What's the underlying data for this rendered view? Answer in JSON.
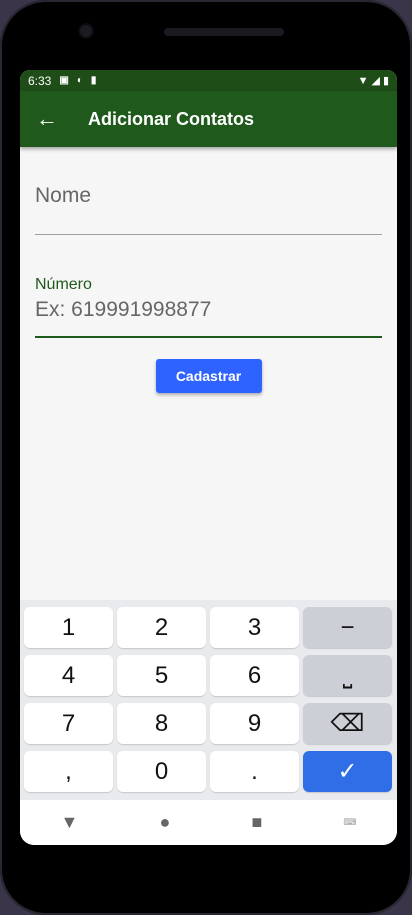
{
  "status_bar": {
    "time": "6:33",
    "icons": [
      "a-icon",
      "p-icon",
      "sd-card-icon"
    ],
    "right_icons": [
      "wifi-icon",
      "signal-icon",
      "battery-icon"
    ]
  },
  "app_bar": {
    "title": "Adicionar Contatos",
    "back_icon": "arrow-back-icon"
  },
  "form": {
    "name_placeholder": "Nome",
    "number_label": "Número",
    "number_placeholder": "Ex: 619991998877",
    "submit_label": "Cadastrar"
  },
  "keyboard": {
    "rows": [
      [
        "1",
        "2",
        "3",
        "−"
      ],
      [
        "4",
        "5",
        "6",
        "⎵"
      ],
      [
        "7",
        "8",
        "9",
        "⌫"
      ],
      [
        ",",
        "0",
        ".",
        "✓"
      ]
    ]
  },
  "nav_bar": {
    "back": "▼",
    "home": "●",
    "recents": "■",
    "keyboard_switch": "⌨"
  },
  "colors": {
    "app_bar": "#1f5a1c",
    "status_bar": "#1e4d17",
    "button": "#2f63ff",
    "enter_key": "#2f6ee6"
  }
}
